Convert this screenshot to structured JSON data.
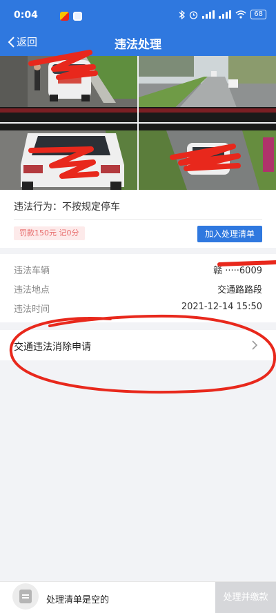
{
  "status_bar": {
    "time": "0:04",
    "battery": "68"
  },
  "nav": {
    "back_label": "返回",
    "title": "违法处理"
  },
  "violation": {
    "behavior_label": "违法行为：",
    "behavior_value": "不按规定停车",
    "fine_tag": "罚款150元 记0分",
    "add_button": "加入处理清单"
  },
  "details": [
    {
      "label": "违法车辆",
      "value": "赣 ·····6009"
    },
    {
      "label": "违法地点",
      "value": "交通路路段"
    },
    {
      "label": "违法时间",
      "value": "2021-12-14 15:50"
    }
  ],
  "apply": {
    "label": "交通违法消除申请"
  },
  "bottom": {
    "empty_text": "处理清单是空的",
    "pay_button": "处理并缴款"
  },
  "colors": {
    "brand": "#2f78df",
    "fine": "#e76a6a",
    "annotation": "#e8281c"
  },
  "icons": [
    "back-chevron-icon",
    "chevron-right-icon",
    "list-icon",
    "bluetooth-icon",
    "alarm-icon",
    "wifi-icon",
    "battery-icon"
  ]
}
